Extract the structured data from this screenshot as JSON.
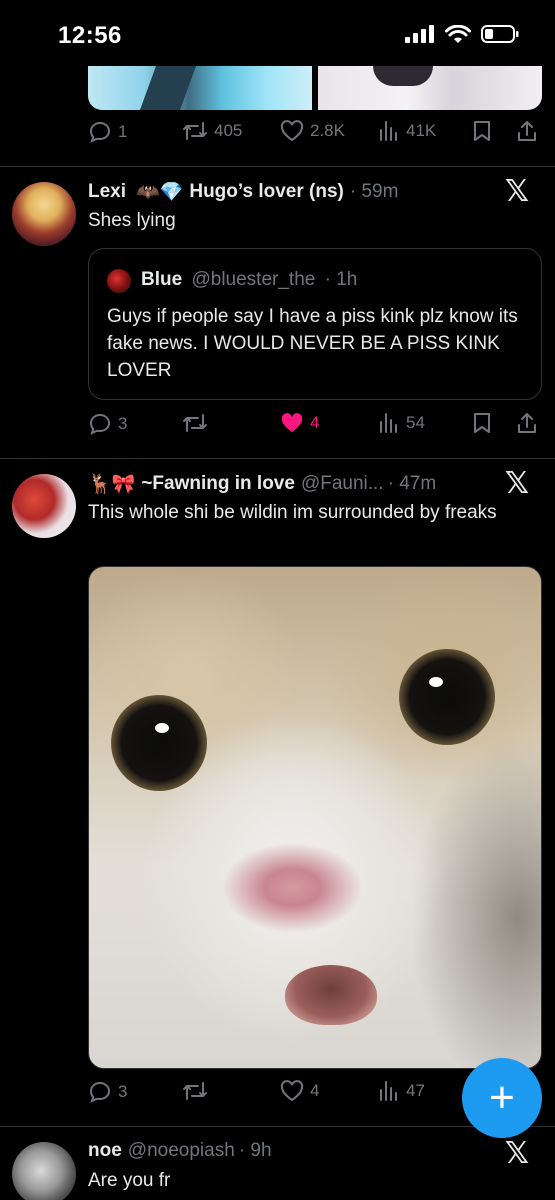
{
  "status_bar": {
    "time": "12:56"
  },
  "tweet_prev": {
    "actions": {
      "replies": "1",
      "retweets": "405",
      "likes": "2.8K",
      "views": "41K"
    }
  },
  "tweet_lexi": {
    "name": "Lexi",
    "emoji": "🦇💎",
    "display_suffix": "Hugo’s lover (ns)",
    "time": "· 59m",
    "text": "Shes lying",
    "quote": {
      "name": "Blue",
      "handle": "@bluester_the",
      "time": "· 1h",
      "text": "Guys if people say I have a piss kink plz know its fake news. I WOULD NEVER BE A PISS KINK LOVER"
    },
    "actions": {
      "replies": "3",
      "retweets": "",
      "likes": "4",
      "views": "54"
    }
  },
  "tweet_fawning": {
    "emoji": "🦌🎀",
    "name": "~Fawning in love",
    "handle": "@Fauni...",
    "time": "· 47m",
    "text": "This whole shi be wildin im surrounded by freaks",
    "actions": {
      "replies": "3",
      "retweets": "",
      "likes": "4",
      "views": "47"
    }
  },
  "tweet_noe": {
    "name": "noe",
    "handle": "@noeopiash",
    "time": "· 9h",
    "text": "Are you fr"
  },
  "fab": {
    "label": "+"
  },
  "x_logo": "𝕏",
  "colors": {
    "accent": "#1d9bf0",
    "like": "#f91880",
    "muted": "#71767b",
    "background": "#000000"
  }
}
